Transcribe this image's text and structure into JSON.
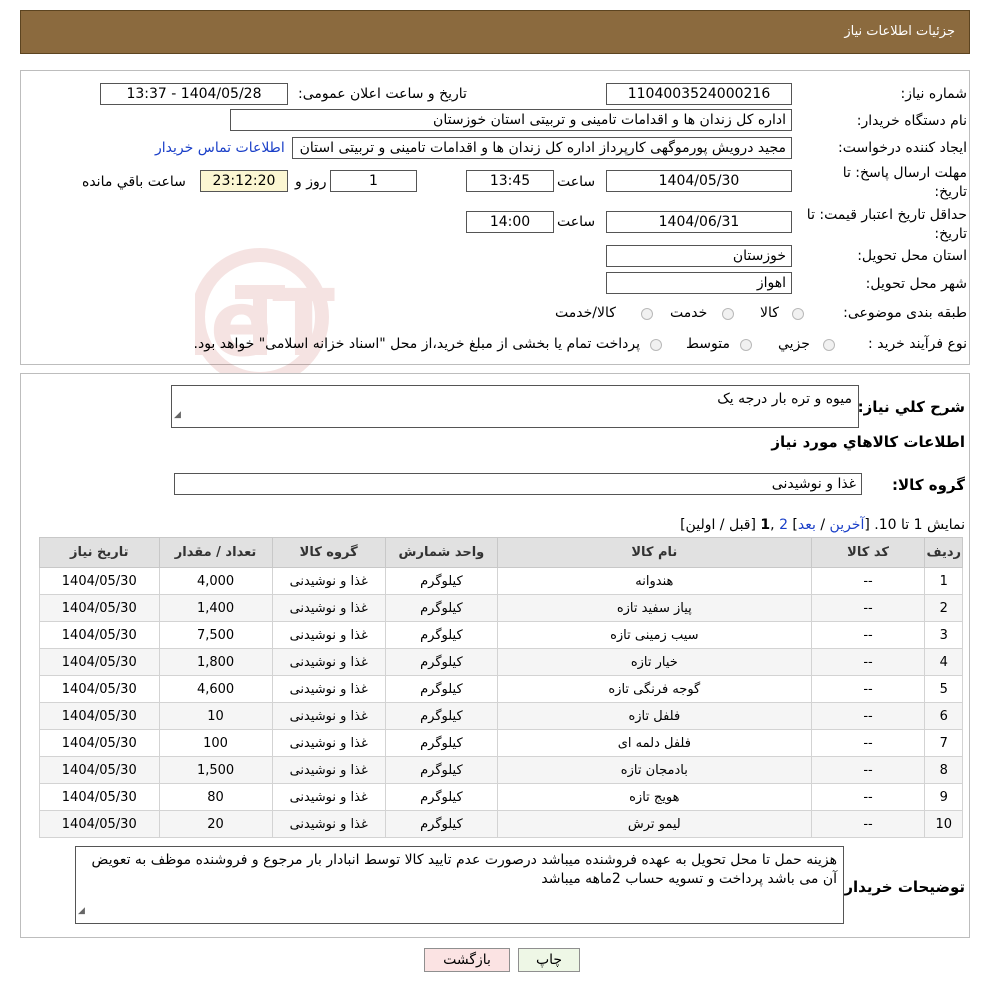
{
  "header": {
    "title": "جزئیات اطلاعات نیاز"
  },
  "form": {
    "need_number_label": "شماره نیاز:",
    "need_number": "1104003524000216",
    "announce_label": "تاریخ و ساعت اعلان عمومی:",
    "announce_value": "1404/05/28 - 13:37",
    "buyer_org_label": "نام دستگاه خریدار:",
    "buyer_org": "اداره کل زندان ها و اقدامات تامینی و تربیتی استان خوزستان",
    "requester_label": "ایجاد کننده درخواست:",
    "requester": "مجید درویش پورموگهی کارپرداز اداره کل زندان ها و اقدامات تامینی و تربیتی استان",
    "buyer_contact_link": "اطلاعات تماس خریدار",
    "deadline_label": "مهلت ارسال پاسخ: تا تاریخ:",
    "deadline_date": "1404/05/30",
    "hour_label": "ساعت",
    "deadline_time": "13:45",
    "days_value": "1",
    "day_and_label": "روز و",
    "remaining_time": "23:12:20",
    "remaining_label": "ساعت باقي مانده",
    "validity_label": "حداقل تاریخ اعتبار قیمت: تا تاریخ:",
    "validity_date": "1404/06/31",
    "validity_time": "14:00",
    "province_label": "استان محل تحویل:",
    "province": "خوزستان",
    "city_label": "شهر محل تحویل:",
    "city": "اهواز",
    "category_label": "طبقه بندی موضوعی:",
    "category_options": [
      "کالا",
      "خدمت",
      "کالا/خدمت"
    ],
    "process_label": "نوع فرآیند خرید :",
    "process_options": [
      "جزیي",
      "متوسط"
    ],
    "payment_note": "پرداخت تمام یا بخشی از مبلغ خرید،از محل \"اسناد خزانه اسلامی\" خواهد بود."
  },
  "details": {
    "summary_label": "شرح کلي نیاز:",
    "summary": "میوه و تره بار درجه یک",
    "goods_info_title": "اطلاعات کالاهاي مورد نیاز",
    "goods_group_label": "گروه کالا:",
    "goods_group": "غذا و نوشیدنی",
    "pagination": {
      "prefix": "نمایش 1 تا 10. [",
      "last": "آخرین",
      "sep1": " / ",
      "next": "بعد",
      "sep2": "] ",
      "page2": "2",
      "comma": " ,",
      "page1": "1",
      "suffix": " [قبل / اولین]"
    },
    "table": {
      "headers": [
        "ردیف",
        "کد کالا",
        "نام کالا",
        "واحد شمارش",
        "گروه کالا",
        "تعداد / مقدار",
        "تاریخ نیاز"
      ],
      "rows": [
        [
          "1",
          "--",
          "هندوانه",
          "کیلوگرم",
          "غذا و نوشیدنی",
          "4,000",
          "1404/05/30"
        ],
        [
          "2",
          "--",
          "پیاز سفید تازه",
          "کیلوگرم",
          "غذا و نوشیدنی",
          "1,400",
          "1404/05/30"
        ],
        [
          "3",
          "--",
          "سیب زمینی تازه",
          "کیلوگرم",
          "غذا و نوشیدنی",
          "7,500",
          "1404/05/30"
        ],
        [
          "4",
          "--",
          "خیار تازه",
          "کیلوگرم",
          "غذا و نوشیدنی",
          "1,800",
          "1404/05/30"
        ],
        [
          "5",
          "--",
          "گوجه فرنگی تازه",
          "کیلوگرم",
          "غذا و نوشیدنی",
          "4,600",
          "1404/05/30"
        ],
        [
          "6",
          "--",
          "فلفل تازه",
          "کیلوگرم",
          "غذا و نوشیدنی",
          "10",
          "1404/05/30"
        ],
        [
          "7",
          "--",
          "فلفل دلمه ای",
          "کیلوگرم",
          "غذا و نوشیدنی",
          "100",
          "1404/05/30"
        ],
        [
          "8",
          "--",
          "بادمجان تازه",
          "کیلوگرم",
          "غذا و نوشیدنی",
          "1,500",
          "1404/05/30"
        ],
        [
          "9",
          "--",
          "هویج تازه",
          "کیلوگرم",
          "غذا و نوشیدنی",
          "80",
          "1404/05/30"
        ],
        [
          "10",
          "--",
          "لیمو ترش",
          "کیلوگرم",
          "غذا و نوشیدنی",
          "20",
          "1404/05/30"
        ]
      ]
    },
    "buyer_notes_label": "توضیحات خریدار:",
    "buyer_notes": "هزینه حمل تا محل تحویل به عهده فروشنده میباشد درصورت عدم تایید کالا توسط انبادار بار مرجوع و فروشنده موظف به تعویض آن می باشد پرداخت و تسویه حساب  2ماهه میباشد"
  },
  "buttons": {
    "print": "چاپ",
    "back": "بازگشت"
  },
  "watermark": {
    "text": "AriaTender.neT"
  },
  "colors": {
    "header_bg": "#8b6a3e",
    "link": "#1a3fc8",
    "back_button_bg": "#fbe3e3",
    "print_button_bg": "#eef7e6"
  }
}
